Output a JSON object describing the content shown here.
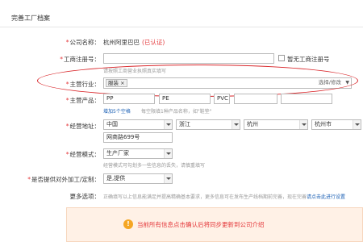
{
  "header": {
    "title": "完善工厂档案"
  },
  "company": {
    "label": "公司名称：",
    "value": "杭州阿里巴巴",
    "certified": "(已认证)"
  },
  "registration": {
    "label": "工商注册号：",
    "value": "",
    "no_reg_label": "暂无工商注册号",
    "hint": "请按照工商营业执照真实填写"
  },
  "industry": {
    "label": "主营行业：",
    "tag": "服装",
    "dropdown_label": "选择/修改"
  },
  "products": {
    "label": "主营产品：",
    "values": [
      "PP",
      "PE",
      "PVC",
      "",
      ""
    ],
    "add_link": "增加5个空格",
    "hint": "每空限填1种产品名称，如\"鞋垫\""
  },
  "address": {
    "label": "经营地址：",
    "country": "中国",
    "province": "浙江",
    "city": "杭州",
    "district": "杭州市",
    "street": "网商路699号"
  },
  "business_mode": {
    "label": "经营模式：",
    "selected": "生产厂家",
    "hint": "经营模式可勾划多一些信息的丢失，请慎重填写"
  },
  "oem": {
    "label": "是否提供对外加工/定制：",
    "selected": "是,提供"
  },
  "more_options": {
    "label": "更多选项：",
    "text": "正确填写以上信息能满足并提高精确基本要求，更多信息可在发布生产线档期前完善，现在完善",
    "link": "请点击此进行设置"
  },
  "notice": {
    "icon": "warning-icon",
    "message": "当前所有信息点击确认后将同步更新到公司介绍"
  },
  "colors": {
    "required": "#e4393c",
    "link": "#1a5fb4",
    "notice_bg": "#fff1e6",
    "annotation": "#d9262a"
  }
}
